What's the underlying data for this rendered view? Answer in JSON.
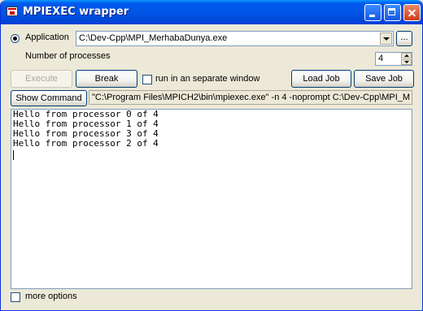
{
  "window": {
    "title": "MPIEXEC wrapper"
  },
  "app_icon": "mpiexec-app-icon",
  "application": {
    "label": "Application",
    "value": "C:\\Dev-Cpp\\MPI_MerhabaDunya.exe",
    "browse_label": "..."
  },
  "processes": {
    "label": "Number of processes",
    "value": "4"
  },
  "toolbar": {
    "execute_label": "Execute",
    "break_label": "Break",
    "separate_window_label": "run in an separate window",
    "load_job_label": "Load Job",
    "save_job_label": "Save Job"
  },
  "command": {
    "show_label": "Show Command",
    "text": "\"C:\\Program Files\\MPICH2\\bin\\mpiexec.exe\" -n 4  -noprompt C:\\Dev-Cpp\\MPI_M"
  },
  "output": {
    "lines": [
      "Hello from processor 0 of 4",
      "Hello from processor 1 of 4",
      "Hello from processor 3 of 4",
      "Hello from processor 2 of 4"
    ]
  },
  "more_options": {
    "label": "more options"
  }
}
